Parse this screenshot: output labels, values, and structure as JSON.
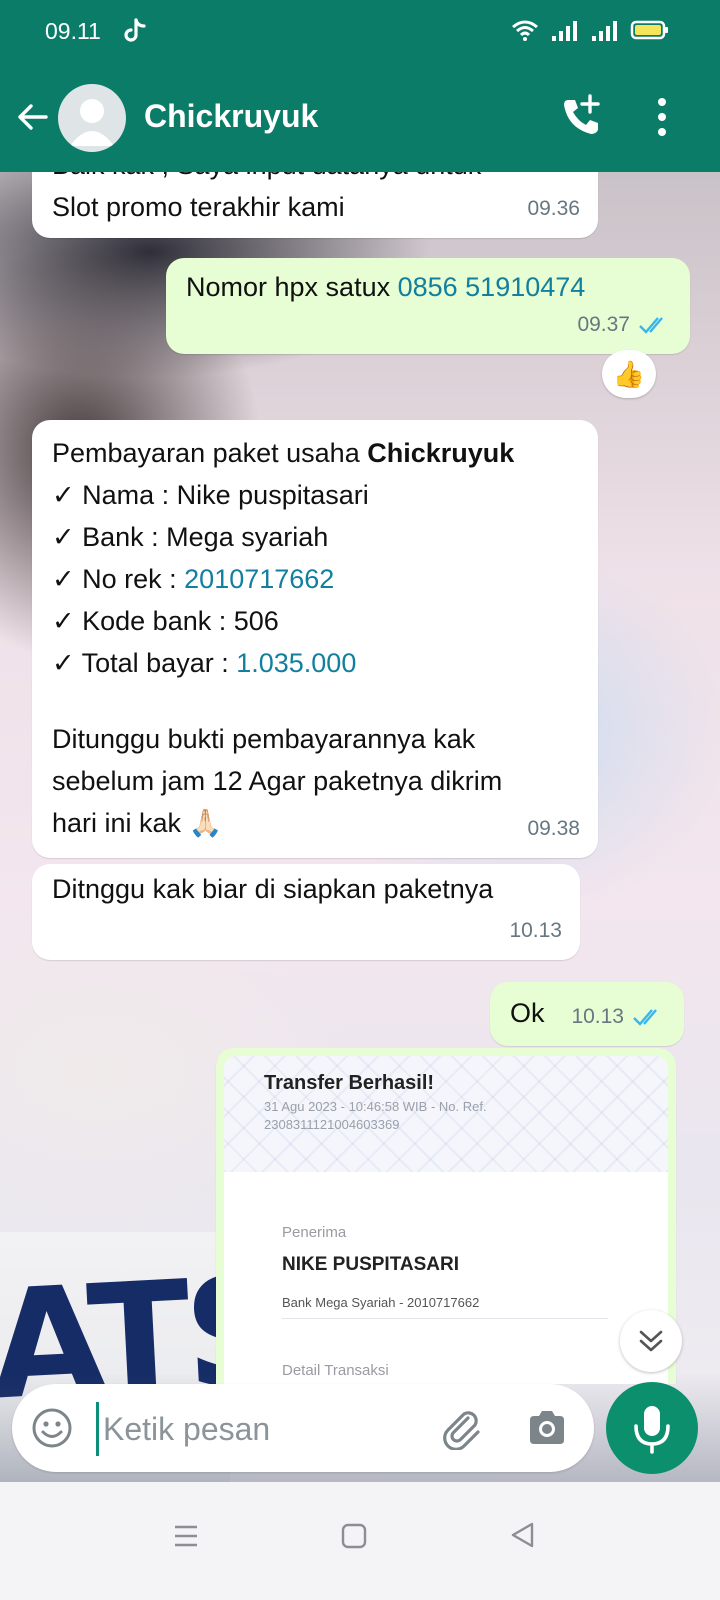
{
  "status_bar": {
    "time": "09.11"
  },
  "header": {
    "contact_name": "Chickruyuk"
  },
  "messages": {
    "m1": {
      "line_partial": "Baik kak , Saya input datanya untuk",
      "line": "Slot promo terakhir kami",
      "time": "09.36"
    },
    "m2": {
      "prefix": "Nomor hpx satux ",
      "phone": "0856 51910474",
      "time": "09.37",
      "reaction": "👍"
    },
    "m3": {
      "intro": "Pembayaran paket usaha ",
      "intro_bold": "Chickruyuk",
      "nama": "✓ Nama : Nike puspitasari",
      "bank": "✓ Bank : Mega syariah",
      "rek_label": "✓ No rek : ",
      "rek_value": "2010717662",
      "kode": "✓ Kode bank : 506",
      "total_label": "✓ Total bayar : ",
      "total_value": "1.035.000",
      "p1": "Ditunggu bukti pembayarannya kak",
      "p2": "sebelum jam 12 Agar paketnya dikrim",
      "p3": "hari ini kak 🙏🏻",
      "time": "09.38"
    },
    "m4": {
      "text": "Ditnggu kak biar di siapkan paketnya",
      "time": "10.13"
    },
    "m5": {
      "text": "Ok",
      "time": "10.13"
    },
    "m6": {
      "title": "Transfer Berhasil!",
      "date": "31 Agu 2023 - 10:46:58 WIB - No. Ref.",
      "ref": "2308311121004603369",
      "penerima_label": "Penerima",
      "penerima_name": "NIKE PUSPITASARI",
      "bank": "Bank Mega Syariah - 2010717662",
      "detail_label": "Detail Transaksi"
    }
  },
  "input": {
    "placeholder": "Ketik pesan"
  },
  "colors": {
    "header": "#0b7c68",
    "outgoing": "#e7fdd3",
    "link": "#127f9e",
    "tick": "#34b7f1",
    "mic": "#0b8f6c"
  },
  "icons": [
    "tiktok-icon",
    "wifi-icon",
    "signal-icon",
    "battery-icon",
    "back-arrow-icon",
    "call-add-icon",
    "more-vert-icon",
    "emoji-icon",
    "attach-icon",
    "camera-icon",
    "mic-icon",
    "chevrons-down-icon"
  ]
}
